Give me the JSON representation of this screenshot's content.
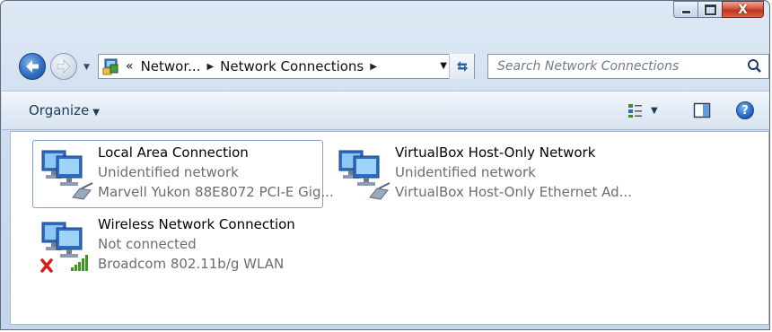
{
  "window": {
    "close_glyph": "X"
  },
  "nav": {
    "breadcrumb_overflow": "«",
    "breadcrumbs": [
      "Networ...",
      "Network Connections"
    ],
    "search_placeholder": "Search Network Connections"
  },
  "toolbar": {
    "organize_label": "Organize"
  },
  "connections": [
    {
      "name": "Local Area Connection",
      "status": "Unidentified network",
      "device": "Marvell Yukon 88E8072 PCI-E Gig...",
      "type": "wired",
      "selected": true
    },
    {
      "name": "VirtualBox Host-Only Network",
      "status": "Unidentified network",
      "device": "VirtualBox Host-Only Ethernet Ad...",
      "type": "wired",
      "selected": false
    },
    {
      "name": "Wireless Network Connection",
      "status": "Not connected",
      "device": "Broadcom 802.11b/g WLAN",
      "type": "wireless",
      "selected": false
    }
  ],
  "colors": {
    "accent": "#2f6fc2",
    "selection_border": "#7da2ce",
    "error_red": "#d4211a",
    "signal_green": "#3a9a1c"
  }
}
